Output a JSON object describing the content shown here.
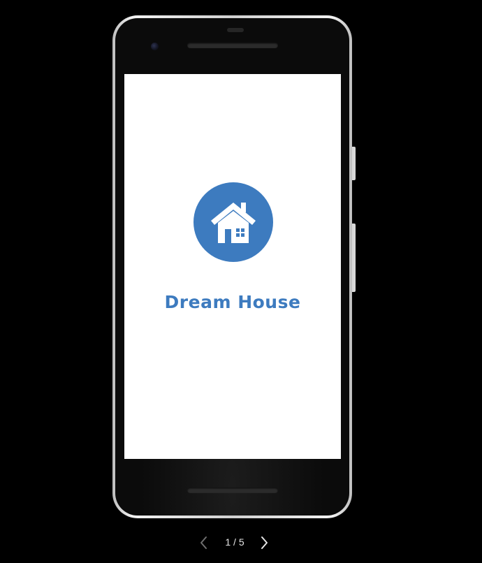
{
  "viewer": {
    "counter": "1 / 5",
    "prev_icon": "chevron-left-icon",
    "next_icon": "chevron-right-icon",
    "prev_color": "#6f6f6f",
    "next_color": "#e6e6e6"
  },
  "app": {
    "name": "Dream House",
    "logo_icon": "house-icon",
    "brand_color": "#3d7bbf",
    "screen_background": "#ffffff"
  }
}
